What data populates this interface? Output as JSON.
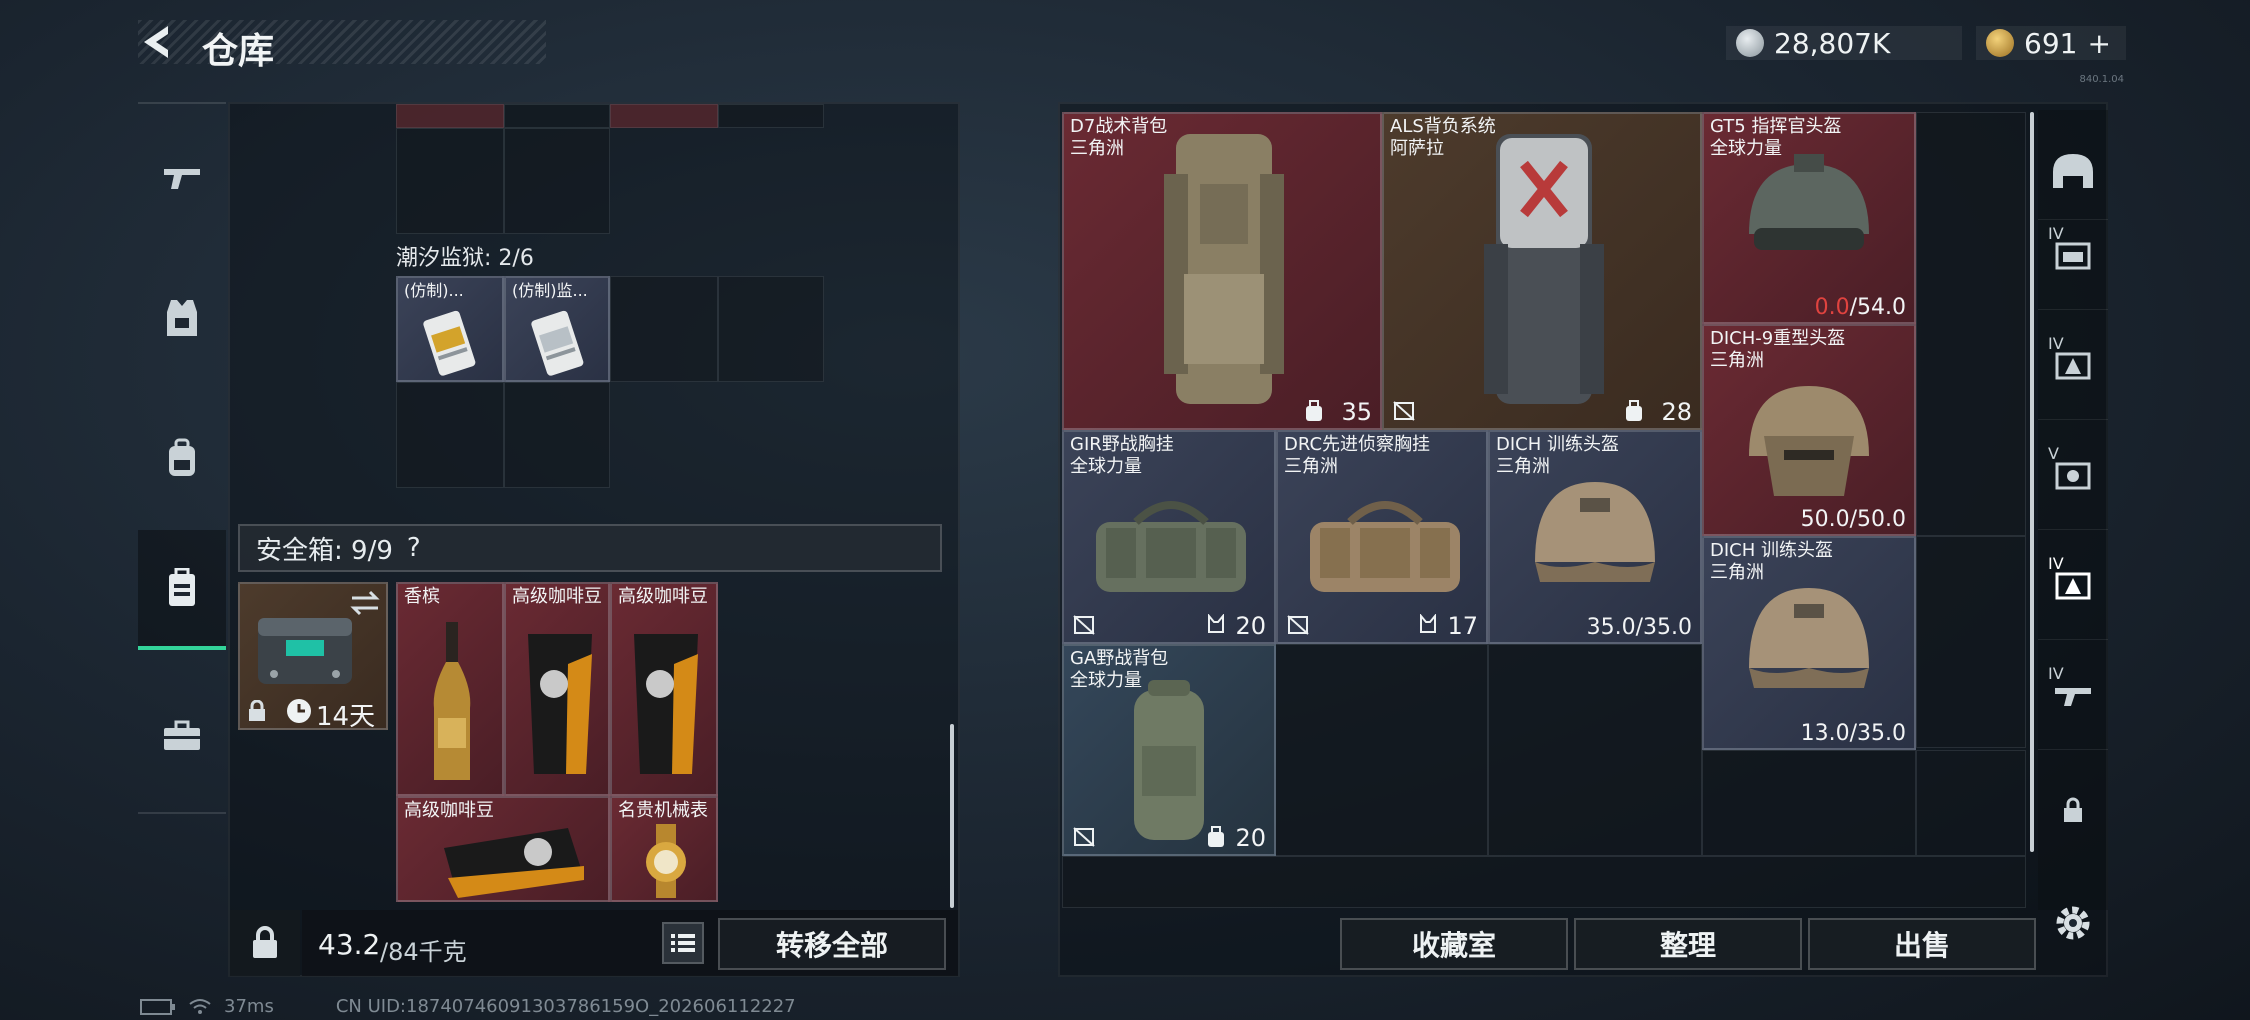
{
  "header": {
    "title": "仓库",
    "back_icon": "back-arrow-icon"
  },
  "currency": {
    "silver": "28,807K",
    "gold": "691",
    "gold_add": "+"
  },
  "version_text": "840.1.04",
  "left_nav": [
    {
      "name": "weapons",
      "icon": "gun-icon"
    },
    {
      "name": "armor",
      "icon": "vest-icon"
    },
    {
      "name": "backpack",
      "icon": "backpack-icon"
    },
    {
      "name": "safe-box",
      "icon": "safebox-icon",
      "active": true
    },
    {
      "name": "case",
      "icon": "case-icon"
    }
  ],
  "left_panel": {
    "section_label": "潮汐监狱: 2/6",
    "section_items": [
      {
        "name": "(仿制)..."
      },
      {
        "name": "(仿制)监..."
      }
    ],
    "safebox_label": "安全箱: 9/9",
    "safebox_help": "?",
    "safebox_timer": "14天",
    "safebox_items": [
      {
        "name": "香槟"
      },
      {
        "name": "高级咖啡豆"
      },
      {
        "name": "高级咖啡豆"
      },
      {
        "name": "高级咖啡豆"
      },
      {
        "name": "名贵机械表"
      }
    ],
    "weight_value": "43.2",
    "weight_total": "/84千克",
    "transfer_all": "转移全部"
  },
  "right_items": [
    {
      "name": "D7战术背包",
      "sub": "三角洲",
      "stat": "35"
    },
    {
      "name": "ALS背负系统",
      "sub": "阿萨拉",
      "stat": "28"
    },
    {
      "name": "GT5 指挥官头盔",
      "sub": "全球力量",
      "dur_cur": "0.0",
      "dur_max": "/54.0"
    },
    {
      "name": "DICH-9重型头盔",
      "sub": "三角洲",
      "dur": "50.0/50.0"
    },
    {
      "name": "GIR野战胸挂",
      "sub": "全球力量",
      "stat": "20"
    },
    {
      "name": "DRC先进侦察胸挂",
      "sub": "三角洲",
      "stat": "17"
    },
    {
      "name": "DICH 训练头盔",
      "sub": "三角洲",
      "dur": "35.0/35.0"
    },
    {
      "name": "DICH 训练头盔",
      "sub": "三角洲",
      "dur": "13.0/35.0"
    },
    {
      "name": "GA野战背包",
      "sub": "全球力量",
      "stat": "20"
    }
  ],
  "bottom_buttons": {
    "collection": "收藏室",
    "organize": "整理",
    "sell": "出售"
  },
  "right_nav": [
    "helmet-icon",
    "vest-iv-icon",
    "armor-iv-icon",
    "backpack-v-icon",
    "armor-iv-active-icon",
    "gun-iv-icon",
    "lock-icon",
    "settings-icon"
  ],
  "right_nav_tiers": {
    "t1": "IV",
    "t2": "IV",
    "t3": "V",
    "t4": "IV",
    "t5": "IV"
  },
  "status": {
    "ping": "37ms",
    "uid": "CN UID:18740746091303786159O_202606112227"
  }
}
